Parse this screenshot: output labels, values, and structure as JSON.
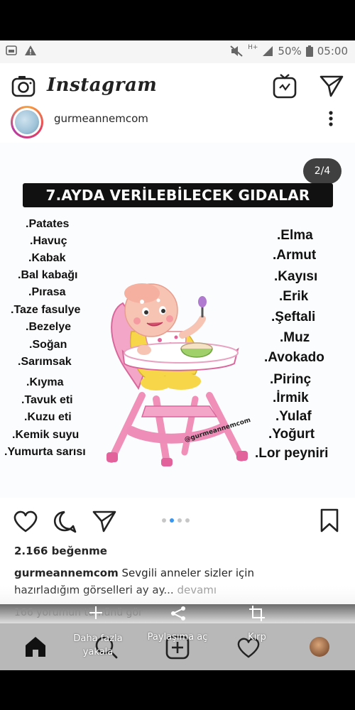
{
  "status_bar": {
    "battery": "50%",
    "time": "05:00",
    "network": "H+"
  },
  "app": {
    "title": "Instagram"
  },
  "post": {
    "username": "gurmeannemcom",
    "image_counter": "2/4",
    "image_title": "7.AYDA VERİLEBİLECEK GIDALAR",
    "left_foods": [
      ".Patates",
      ".Havuç",
      ".Kabak",
      ".Bal kabağı",
      ".Pırasa",
      ".Taze fasulye",
      ".Bezelye",
      ".Soğan",
      ".Sarımsak",
      ".Kıyma",
      ".Tavuk eti",
      ".Kuzu eti",
      ".Kemik suyu",
      ".Yumurta sarısı"
    ],
    "right_foods": [
      ".Elma",
      ".Armut",
      ".Kayısı",
      ".Erik",
      ".Şeftali",
      ".Muz",
      ".Avokado",
      ".Pirinç",
      ".İrmik",
      ".Yulaf",
      ".Yoğurt",
      ".Lor peyniri"
    ],
    "watermark": "@gurmeannemcom",
    "likes": "2.166 beğenme",
    "caption_user": "gurmeannemcom",
    "caption_text_1": "Sevgili anneler sizler için",
    "caption_text_2": "hazırladığım görselleri ay ay...",
    "caption_more": "devamı",
    "comments": "166 yorumun tümünü gör"
  },
  "overlay_menu": {
    "item1_line1": "Daha fazla",
    "item1_line2": "yakala",
    "item2": "Paylaşıma aç",
    "item3": "Kırp"
  },
  "colors": {
    "accent": "#3897f0",
    "chair": "#f3a6c8"
  }
}
